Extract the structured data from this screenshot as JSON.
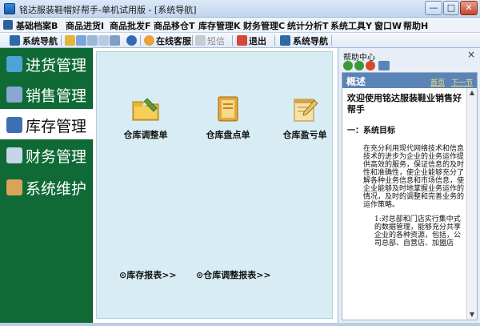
{
  "window": {
    "title": "铭达服装鞋帽好帮手-单机试用版 - [系统导航]",
    "minimize_glyph": "—",
    "maximize_glyph": "□",
    "close_glyph": "✕"
  },
  "menu": {
    "items": [
      {
        "label": "基础档案B"
      },
      {
        "label": "商品进货I"
      },
      {
        "label": "商品批发F"
      },
      {
        "label": "商品移仓T"
      },
      {
        "label": "库存管理K"
      },
      {
        "label": "财务管理C"
      },
      {
        "label": "统计分析T"
      },
      {
        "label": "系统工具Y"
      },
      {
        "label": "窗口W"
      },
      {
        "label": "帮助H"
      }
    ]
  },
  "toolbar": {
    "nav_label": "系统导航",
    "service_label": "在线客服",
    "sms_label": "短信",
    "logout_label": "退出",
    "nav2_label": "系统导航"
  },
  "leftnav": {
    "items": [
      {
        "label": "进货管理",
        "icon": "purchase-icon",
        "color": "#4fa3d8"
      },
      {
        "label": "销售管理",
        "icon": "sales-icon",
        "color": "#8aa7d1"
      },
      {
        "label": "库存管理",
        "icon": "inventory-icon",
        "color": "#3d6fb5"
      },
      {
        "label": "财务管理",
        "icon": "finance-icon",
        "color": "#c7d5e8"
      },
      {
        "label": "系统维护",
        "icon": "maintenance-icon",
        "color": "#d9a45a"
      }
    ],
    "active": "库存管理"
  },
  "main": {
    "tiles": [
      {
        "label": "仓库调整单",
        "icon": "folder-edit-icon"
      },
      {
        "label": "仓库盘点单",
        "icon": "ledger-icon"
      },
      {
        "label": "仓库盈亏单",
        "icon": "notepad-edit-icon"
      }
    ],
    "report_links": [
      {
        "label": "⊙库存报表>>"
      },
      {
        "label": "⊙仓库调整报表>>"
      }
    ]
  },
  "help": {
    "title": "帮助中心",
    "close_glyph": "×",
    "doc_header": "概述",
    "link_home": "首页",
    "link_next": "下一节",
    "heading": "欢迎使用铭达服装鞋业销售好帮手",
    "section": "一：系统目标",
    "paragraph": "在充分利用现代网络技术和信息技术的进步为企业的业务运作提供高效的服务，保证信息的及时性和准确性，使企业能够充分了解各种业务信息和市场信息，使企业能够及时地掌握业务运作的情况，及时的调整和完善业务的运作策略。",
    "sub_item": "1:对总部和门店实行集中式的数据管理，能够充分共享企业的各种资源，包括，公司总部、自营店、加盟店"
  },
  "colors": {
    "nav_green": "#0f6a36",
    "panel_bg": "#d8edf3",
    "doc_header_blue": "#5b84b6"
  }
}
